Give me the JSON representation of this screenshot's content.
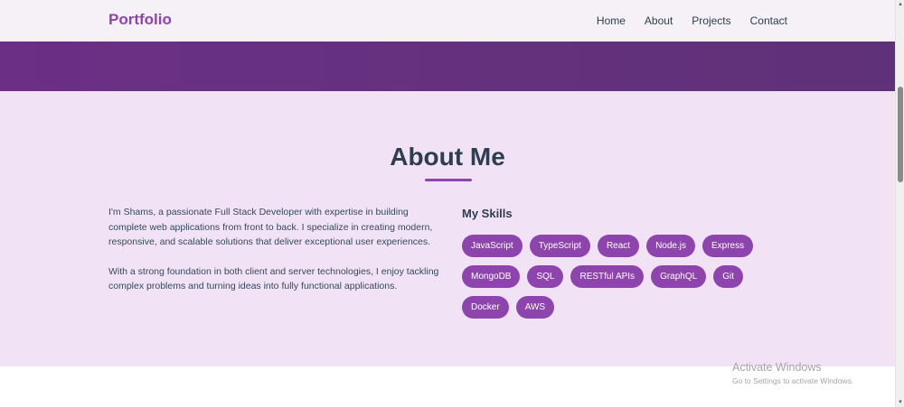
{
  "navbar": {
    "brand": "Portfolio",
    "links": [
      "Home",
      "About",
      "Projects",
      "Contact"
    ]
  },
  "about": {
    "title": "About Me",
    "paragraphs": [
      "I'm Shams, a passionate Full Stack Developer with expertise in building complete web applications from front to back. I specialize in creating modern, responsive, and scalable solutions that deliver exceptional user experiences.",
      "With a strong foundation in both client and server technologies, I enjoy tackling complex problems and turning ideas into fully functional applications."
    ],
    "skills_title": "My Skills",
    "skills": [
      "JavaScript",
      "TypeScript",
      "React",
      "Node.js",
      "Express",
      "MongoDB",
      "SQL",
      "RESTful APIs",
      "GraphQL",
      "Git",
      "Docker",
      "AWS"
    ]
  },
  "watermark": {
    "title": "Activate Windows",
    "subtitle": "Go to Settings to activate Windows."
  },
  "colors": {
    "accent": "#8e44ad",
    "band": "#65317e",
    "section_bg": "#f2e2f6",
    "heading": "#2c3e50"
  }
}
